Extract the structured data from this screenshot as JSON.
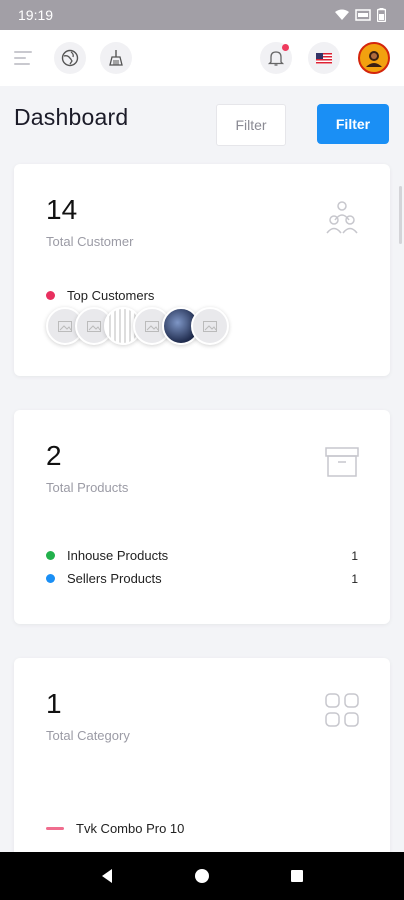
{
  "status": {
    "time": "19:19"
  },
  "header": {
    "title": "Dashboard",
    "filter_placeholder": "Filter",
    "filter_button": "Filter"
  },
  "cards": {
    "customers": {
      "value": "14",
      "caption": "Total Customer",
      "legend": "Top Customers",
      "avatars": [
        "placeholder",
        "placeholder",
        "qr",
        "placeholder",
        "photo",
        "placeholder"
      ]
    },
    "products": {
      "value": "2",
      "caption": "Total Products",
      "rows": [
        {
          "label": "Inhouse Products",
          "count": "1",
          "color": "#22b14c"
        },
        {
          "label": "Sellers Products",
          "count": "1",
          "color": "#1a8ff5"
        }
      ]
    },
    "category": {
      "value": "1",
      "caption": "Total Category",
      "row": {
        "label": "Tvk Combo Pro 10",
        "color": "#f06d8e"
      }
    }
  },
  "colors": {
    "accent": "#1a8ff5",
    "notification_dot": "#ef3b5d",
    "customers_dot": "#e8305f"
  },
  "icons": [
    "menu-icon",
    "globe-icon",
    "broom-icon",
    "bell-icon",
    "us-flag-icon",
    "profile-avatar",
    "users-icon",
    "archive-box-icon",
    "grid-icon"
  ]
}
